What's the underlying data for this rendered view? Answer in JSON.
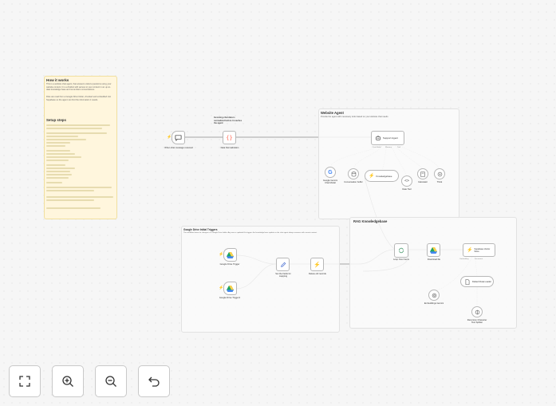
{
  "sticky_notes": {
    "how_it_works": {
      "title": "How it works",
      "intro": "This is a website chat agent, that answers visitors questions using your website content. It is a chatbot with access to your content in an up-to-date knowledge base and remembers conversations.",
      "detail": "Files are read from a Google Drive folder, chunked and embedded into Supabase so the agent can find the information it needs.",
      "setup_title": "Setup steps"
    },
    "website_agent": {
      "title": "Website Agent",
      "subtitle": "Provide the agent with necessary tools based on your website chat needs"
    },
    "google_drive_triggers": {
      "title": "Google Drive Initial Triggers",
      "body": "The workflow listens to changes in a Google Drive folder. Any new or updated file triggers the knowledge base update so the chat agent always answers with current content."
    },
    "rag_knowledgebase": {
      "title": "RAG Knowledgebase"
    },
    "data_normalization_note": "Incoming chat data is normalized before it reaches the agent"
  },
  "nodes": {
    "chat_trigger": {
      "label": "When chat message received"
    },
    "data_normalization": {
      "label": "Data Normalization"
    },
    "support_agent": {
      "label": "Support Agent"
    },
    "gemini_model": {
      "label": "Google Gemini Chat Model"
    },
    "conversation_buffer": {
      "label": "Conversation buffer"
    },
    "knowledgebase": {
      "label": "Knowledgebase"
    },
    "date_tool": {
      "label": "Date Tool"
    },
    "calculator": {
      "label": "Calculator"
    },
    "think": {
      "label": "Think"
    },
    "drive_trigger_1": {
      "label": "Google Drive Trigger"
    },
    "drive_trigger_2": {
      "label": "Google Drive Trigger1"
    },
    "set_fields": {
      "label": "Set the fields for mapping"
    },
    "delete_old": {
      "label": "Delete old records"
    },
    "loop_files": {
      "label": "Loop Over Items"
    },
    "download_file": {
      "label": "Download file"
    },
    "supabase_store": {
      "label": "Supabase Vector Store"
    },
    "default_loader": {
      "label": "Default Data Loader"
    },
    "embeddings": {
      "label": "Embeddings Gemini"
    },
    "text_splitter": {
      "label": "Recursive Character Text Splitter"
    }
  },
  "port_labels": {
    "chat_model": "Chat Model",
    "memory": "Memory",
    "tool": "Tool",
    "embedding": "Embedding",
    "document": "Document",
    "text_splitter": "Text Splitter"
  },
  "controls": {
    "fit_view": "fit-view",
    "zoom_in": "zoom-in",
    "zoom_out": "zoom-out",
    "undo": "undo"
  },
  "colors": {
    "trigger_accent": "#ff6d5a",
    "sticky_yellow": "#fff6dd",
    "connection": "#8c8c8c",
    "ai_link": "#b5b5b5"
  }
}
